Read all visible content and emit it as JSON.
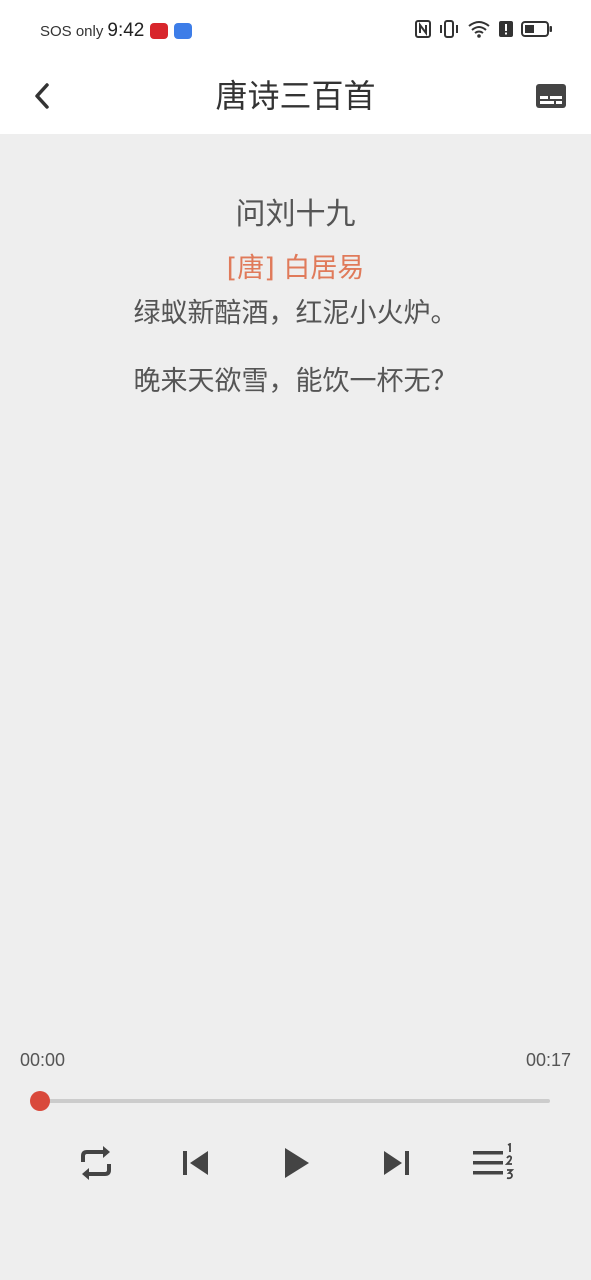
{
  "status_bar": {
    "left_text": "SOS only",
    "time": "9:42",
    "app_badges": [
      "app-badge-red",
      "app-badge-blue"
    ],
    "right_icons": [
      "nfc-icon",
      "vibrate-icon",
      "wifi-icon",
      "alert-icon",
      "battery-icon"
    ],
    "colors": {
      "badge_red": "#d8262c",
      "badge_blue": "#3d7de8"
    }
  },
  "app_bar": {
    "title": "唐诗三百首",
    "back_icon": "chevron-left-icon",
    "subtitle_icon": "subtitles-icon"
  },
  "poem": {
    "title": "问刘十九",
    "author": "[唐] 白居易",
    "lines": [
      "绿蚁新醅酒，红泥小火炉。",
      "晚来天欲雪，能饮一杯无？"
    ]
  },
  "player": {
    "current_time": "00:00",
    "total_time": "00:17",
    "progress": 0,
    "accent_color": "#d9493b",
    "controls": [
      "repeat-icon",
      "previous-icon",
      "play-icon",
      "next-icon",
      "playlist-icon"
    ]
  }
}
